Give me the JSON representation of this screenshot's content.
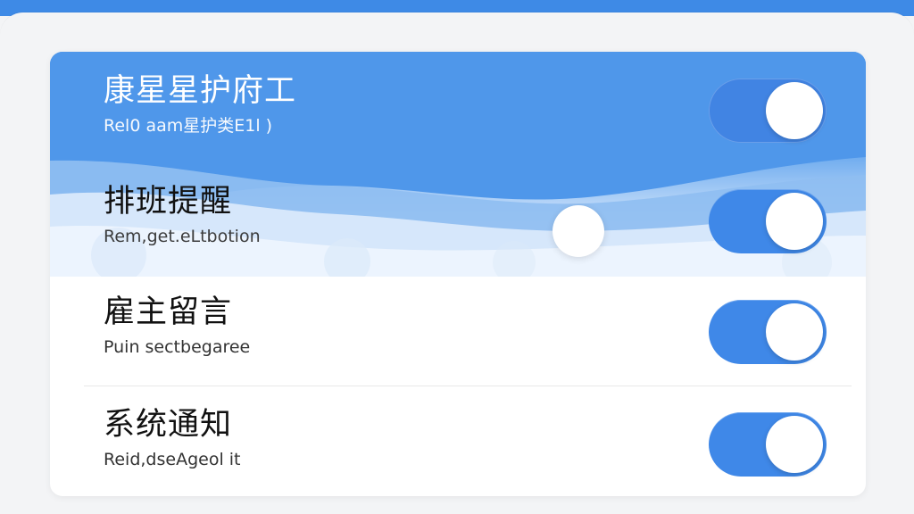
{
  "screen": {
    "accent": "#3e8ae6",
    "background": "#f3f4f6"
  },
  "settings": {
    "items": [
      {
        "title": "康星星护府工",
        "subtitle": "Rel0 aam星护类E1l )",
        "enabled": true
      },
      {
        "title": "排班提醒",
        "subtitle": "Rem,get.eLtbotion",
        "enabled": true
      },
      {
        "title": "雇主留言",
        "subtitle": "Puin sectbegaree",
        "enabled": true
      },
      {
        "title": "系统通知",
        "subtitle": "Reid,dseAgeol it",
        "enabled": true
      }
    ]
  }
}
